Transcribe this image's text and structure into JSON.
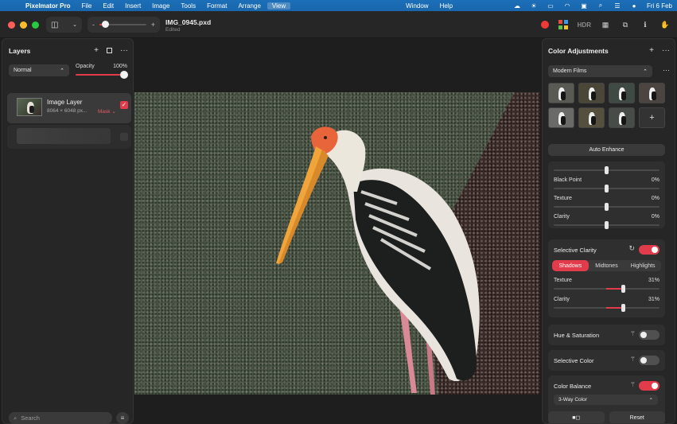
{
  "menubar": {
    "app_name": "Pixelmator Pro",
    "items": [
      "File",
      "Edit",
      "Insert",
      "Image",
      "Tools",
      "Format",
      "Arrange",
      "View"
    ],
    "items_right": [
      "Window",
      "Help"
    ],
    "active_item": "View",
    "clock": "Fri 6 Feb"
  },
  "toolbar": {
    "doc_title": "IMG_0945.pxd",
    "doc_status": "Edited",
    "zoom_minus": "-",
    "zoom_plus": "+",
    "zoom_level_fraction": 0.12,
    "hdr_label": "HDR"
  },
  "layers": {
    "title": "Layers",
    "blend_mode": "Normal",
    "opacity_label": "Opacity",
    "opacity_value": "100%",
    "layer": {
      "name": "Image Layer",
      "dims": "8064 × 6048 px...",
      "mask_label": "Mask",
      "checked": true
    },
    "search_placeholder": "Search"
  },
  "adjustments": {
    "title": "Color Adjustments",
    "preset": "Modern Films",
    "add_preset": "+",
    "auto_enhance": "Auto Enhance",
    "basic": [
      {
        "label": "Black Point",
        "value": "0%"
      },
      {
        "label": "Texture",
        "value": "0%"
      },
      {
        "label": "Clarity",
        "value": "0%"
      }
    ],
    "selective_clarity": {
      "title": "Selective Clarity",
      "enabled": true,
      "tabs": [
        "Shadows",
        "Midtones",
        "Highlights"
      ],
      "active_tab": "Shadows",
      "sliders": [
        {
          "label": "Texture",
          "value": "31%"
        },
        {
          "label": "Clarity",
          "value": "31%"
        }
      ]
    },
    "hue_saturation": {
      "title": "Hue & Saturation",
      "enabled": false
    },
    "selective_color": {
      "title": "Selective Color",
      "enabled": false
    },
    "color_balance": {
      "title": "Color Balance",
      "enabled": true,
      "mode": "3-Way Color"
    },
    "reset_label": "Reset"
  },
  "colors": {
    "accent": "#e23b4b",
    "menubar": "#1a66ac"
  }
}
